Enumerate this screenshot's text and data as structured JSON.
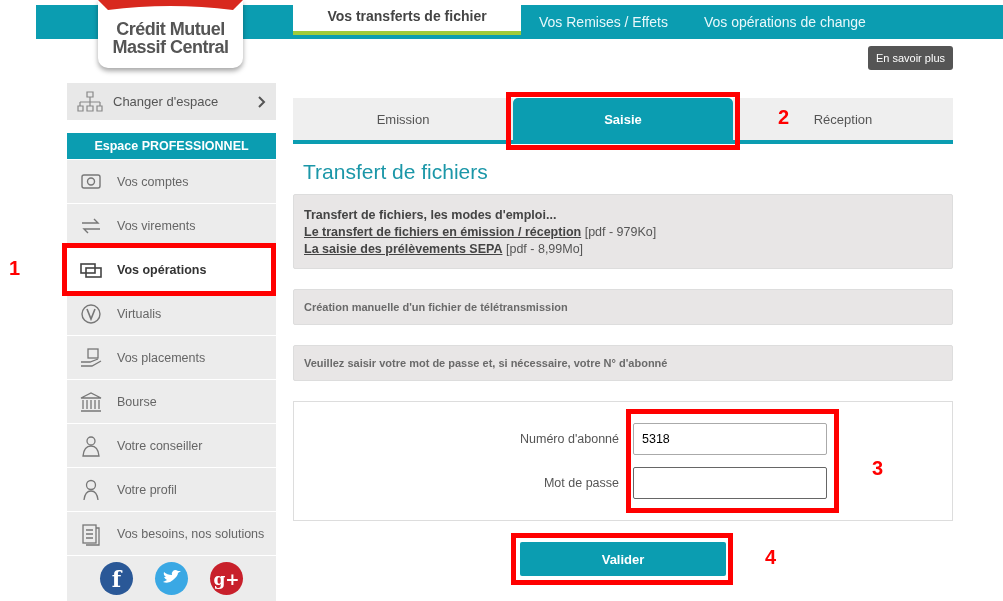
{
  "logo": {
    "lines": [
      "Crédit Mutuel",
      "Massif Central"
    ]
  },
  "top_tabs": [
    {
      "label": "Vos transferts de fichier",
      "selected": true
    },
    {
      "label": "Vos Remises / Effets",
      "selected": false
    },
    {
      "label": "Vos opérations de change",
      "selected": false
    }
  ],
  "info_button": "En savoir plus",
  "sidebar": {
    "switch": "Changer d'espace",
    "header": "Espace PROFESSIONNEL",
    "items": [
      {
        "label": "Vos comptes",
        "selected": false
      },
      {
        "label": "Vos virements",
        "selected": false
      },
      {
        "label": "Vos opérations",
        "selected": true,
        "annotation": "1"
      },
      {
        "label": "Virtualis",
        "selected": false
      },
      {
        "label": "Vos placements",
        "selected": false
      },
      {
        "label": "Bourse",
        "selected": false
      },
      {
        "label": "Votre conseiller",
        "selected": false
      },
      {
        "label": "Votre profil",
        "selected": false
      },
      {
        "label": "Vos besoins, nos solutions",
        "selected": false
      }
    ],
    "social": [
      {
        "kind": "facebook",
        "glyph": "f"
      },
      {
        "kind": "twitter"
      },
      {
        "kind": "googleplus",
        "glyph": "g+"
      }
    ]
  },
  "sub_tabs": [
    {
      "label": "Emission",
      "selected": false
    },
    {
      "label": "Saisie",
      "selected": true,
      "annotation": "2"
    },
    {
      "label": "Réception",
      "selected": false
    }
  ],
  "title": "Transfert de fichiers",
  "docs": {
    "heading": "Transfert de fichiers, les modes d'emploi...",
    "links": [
      {
        "label": "Le transfert de fichiers en émission / réception",
        "note": "[pdf - 979Ko]"
      },
      {
        "label": "La saisie des prélèvements SEPA",
        "note": "[pdf - 8,99Mo]"
      }
    ]
  },
  "notices": [
    "Création manuelle d'un fichier de télétransmission",
    "Veuillez saisir votre mot de passe et, si nécessaire, votre N° d'abonné"
  ],
  "form": {
    "annotation": "3",
    "fields": [
      {
        "label": "Numéro d'abonné",
        "value": "5318",
        "focused": false
      },
      {
        "label": "Mot de passe",
        "focused": true
      }
    ]
  },
  "submit": {
    "label": "Valider",
    "annotation": "4"
  }
}
